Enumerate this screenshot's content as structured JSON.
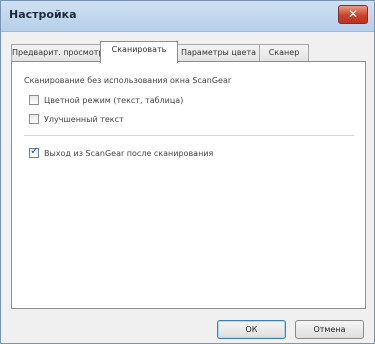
{
  "window": {
    "title": "Настройка",
    "close_glyph": "✕"
  },
  "tabs": [
    {
      "label": "Предварит. просмотр",
      "active": false
    },
    {
      "label": "Сканировать",
      "active": true
    },
    {
      "label": "Параметры цвета",
      "active": false
    },
    {
      "label": "Сканер",
      "active": false
    }
  ],
  "scan_tab": {
    "group_caption": "Сканирование без использования окна ScanGear",
    "options": [
      {
        "label": "Цветной режим (текст, таблица)",
        "checked": false
      },
      {
        "label": "Улучшенный текст",
        "checked": false
      },
      {
        "label": "Выход из ScanGear после сканирования",
        "checked": true
      }
    ],
    "check_glyph": "✓"
  },
  "buttons": {
    "ok": "ОК",
    "cancel": "Отмена"
  },
  "colors": {
    "close_button": "#c9432c",
    "titlebar": "#b7cfea"
  },
  "icons": {
    "close": "close-icon",
    "check": "checkmark-icon"
  }
}
